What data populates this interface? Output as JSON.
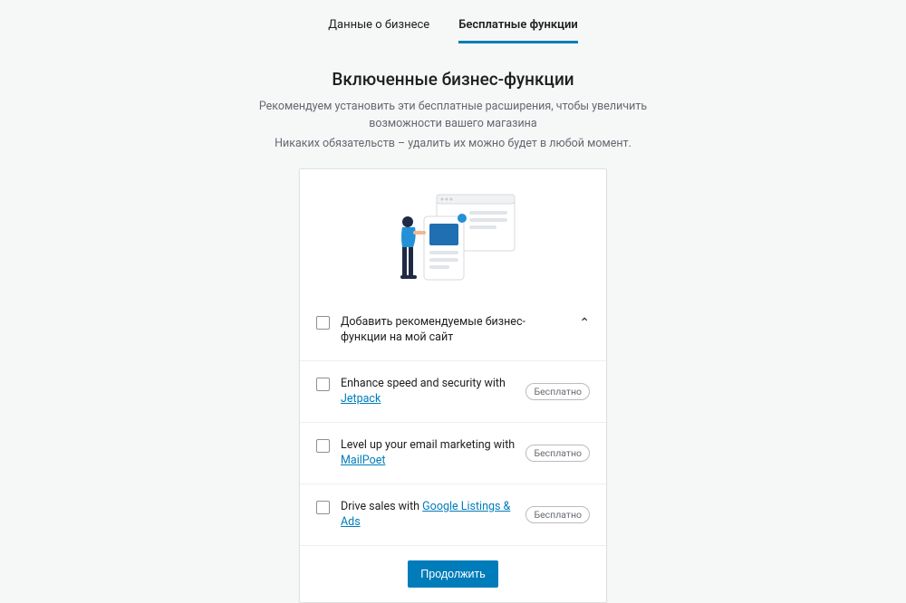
{
  "tabs": {
    "businessData": "Данные о бизнесе",
    "freeFeatures": "Бесплатные функции"
  },
  "header": {
    "title": "Включенные бизнес-функции",
    "line1": "Рекомендуем установить эти бесплатные расширения, чтобы увеличить возможности вашего магазина",
    "line2": "Никаких обязательств – удалить их можно будет в любой момент."
  },
  "features": {
    "addAll": "Добавить рекомендуемые бизнес-функции на мой сайт",
    "jetpack": {
      "prefix": "Enhance speed and security with ",
      "link": "Jetpack"
    },
    "mailpoet": {
      "prefix": "Level up your email marketing with ",
      "link": "MailPoet"
    },
    "google": {
      "prefix": "Drive sales with ",
      "link": "Google Listings & Ads"
    }
  },
  "badge": "Бесплатно",
  "continueBtn": "Продолжить"
}
